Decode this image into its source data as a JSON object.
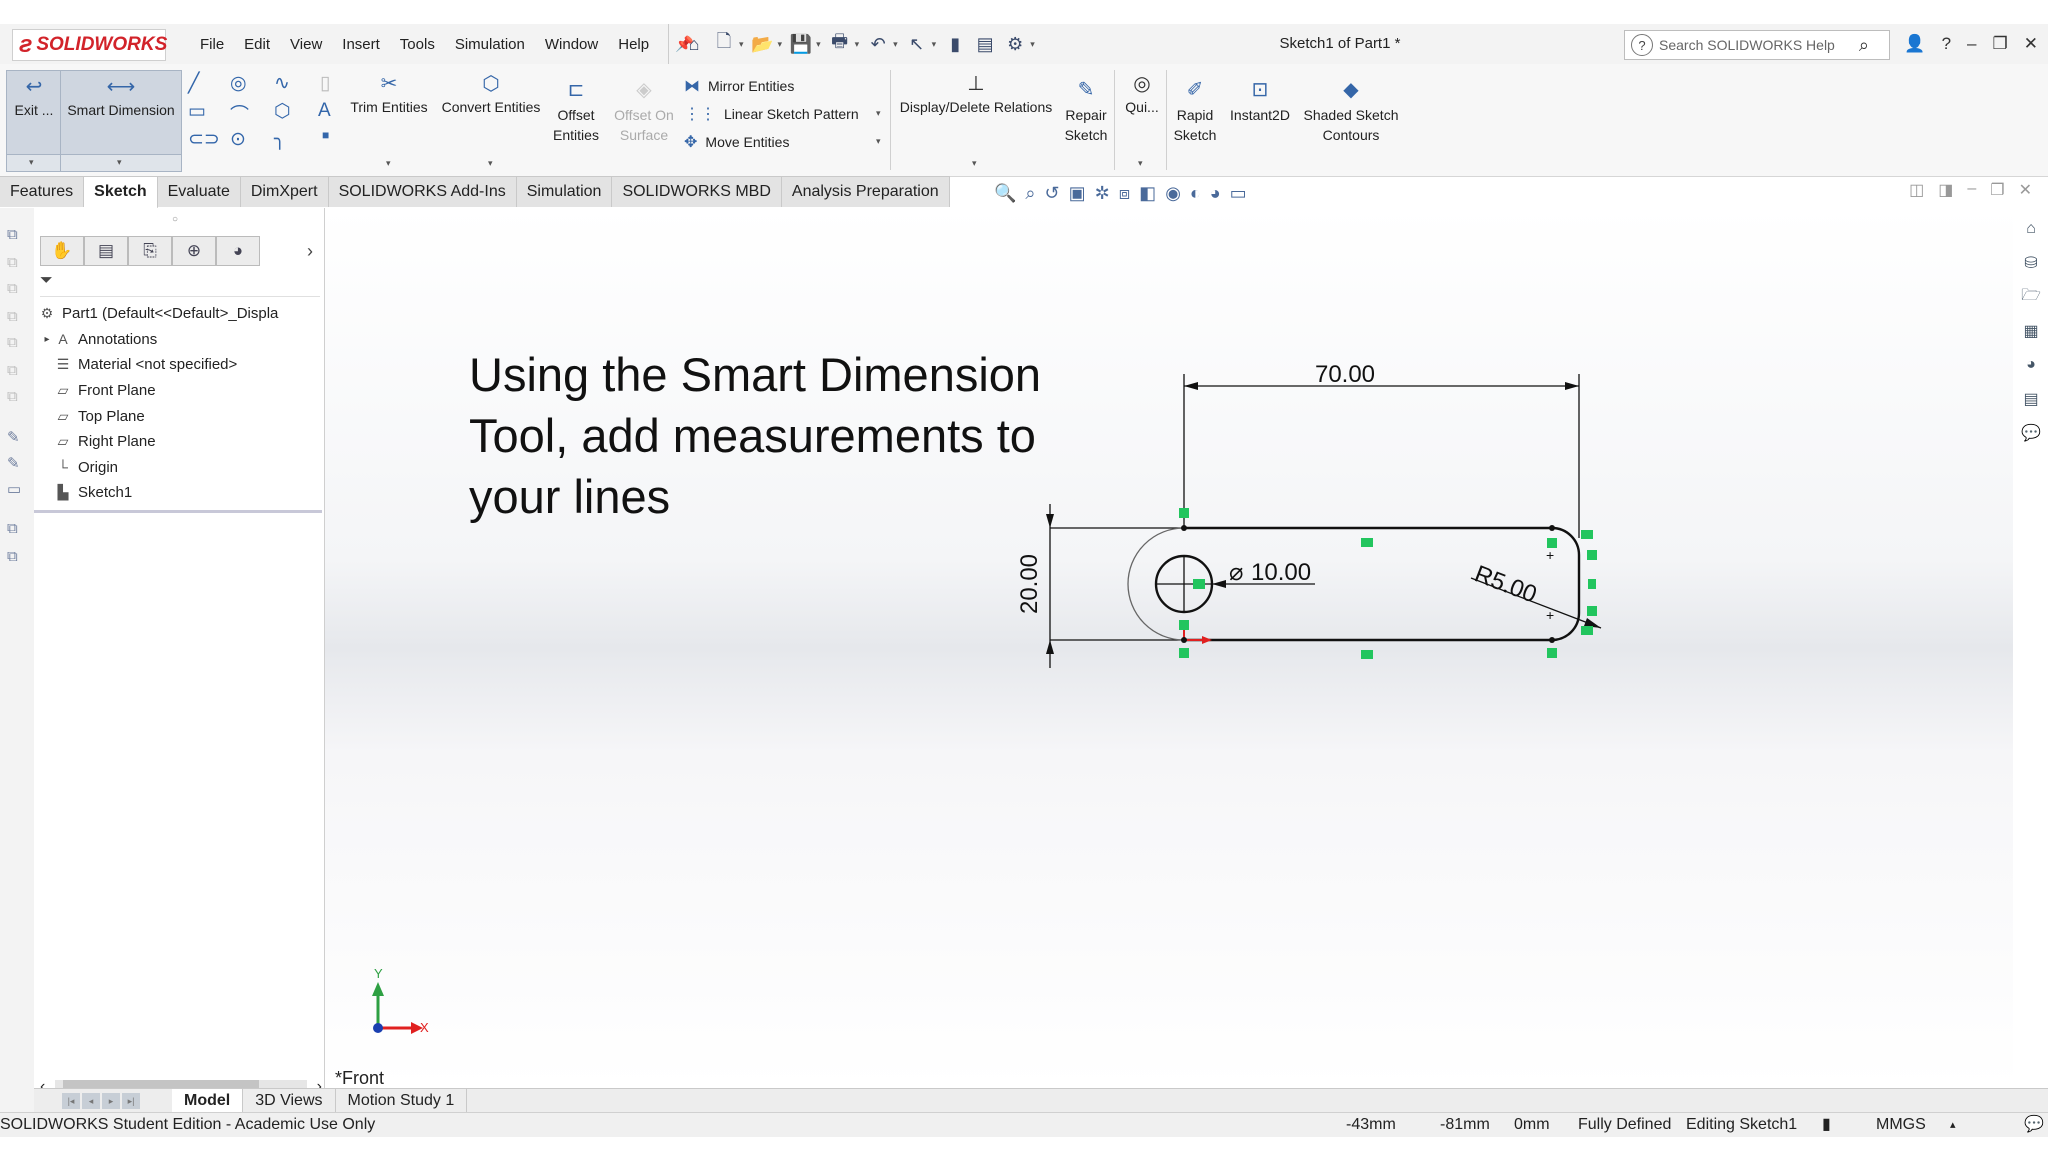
{
  "app": {
    "logo": "SOLIDWORKS",
    "title": "Sketch1 of Part1 *",
    "menu": [
      "File",
      "Edit",
      "View",
      "Insert",
      "Tools",
      "Simulation",
      "Window",
      "Help"
    ],
    "search_placeholder": "Search SOLIDWORKS Help"
  },
  "ribbon": {
    "exit": "Exit ...",
    "smart_dimension": "Smart Dimension",
    "trim": "Trim Entities",
    "convert": "Convert Entities",
    "offset": "Offset Entities",
    "offset_surface": "Offset On Surface",
    "mirror": "Mirror Entities",
    "linear_pattern": "Linear Sketch Pattern",
    "move": "Move Entities",
    "display_relations": "Display/Delete Relations",
    "repair": "Repair Sketch",
    "quick": "Qui...",
    "rapid": "Rapid Sketch",
    "instant2d": "Instant2D",
    "shaded": "Shaded Sketch Contours"
  },
  "tabs": [
    "Features",
    "Sketch",
    "Evaluate",
    "DimXpert",
    "SOLIDWORKS Add-Ins",
    "Simulation",
    "SOLIDWORKS MBD",
    "Analysis Preparation"
  ],
  "active_tab": "Sketch",
  "tree": [
    {
      "label": "Part1  (Default<<Default>_Displa",
      "icon": "part-icon",
      "expandable": false
    },
    {
      "label": "Annotations",
      "icon": "annotations-icon",
      "expandable": true
    },
    {
      "label": "Material <not specified>",
      "icon": "material-icon",
      "expandable": false
    },
    {
      "label": "Front Plane",
      "icon": "plane-icon",
      "expandable": false
    },
    {
      "label": "Top Plane",
      "icon": "plane-icon",
      "expandable": false
    },
    {
      "label": "Right Plane",
      "icon": "plane-icon",
      "expandable": false
    },
    {
      "label": "Origin",
      "icon": "origin-icon",
      "expandable": false
    },
    {
      "label": "Sketch1",
      "icon": "sketch-icon",
      "expandable": false
    }
  ],
  "canvas": {
    "instruction": "Using the Smart Dimension Tool, add measurements to your lines",
    "view_label": "*Front",
    "dim_length": "70.00",
    "dim_height": "20.00",
    "dim_diameter": "10.00",
    "dim_radius": "R5.00",
    "axis_y": "Y",
    "axis_x": "X"
  },
  "bottom_tabs": [
    "Model",
    "3D Views",
    "Motion Study 1"
  ],
  "status": {
    "edition": "SOLIDWORKS Student Edition - Academic Use Only",
    "x": "-43mm",
    "y": "-81mm",
    "z": "0mm",
    "state": "Fully Defined",
    "editing": "Editing Sketch1",
    "units": "MMGS"
  },
  "colors": {
    "accent": "#d2232a",
    "sketch_line": "#1a1a1a",
    "relation": "#22c55e",
    "origin_red": "#e02020",
    "axis_blue": "#1a3fb0"
  }
}
